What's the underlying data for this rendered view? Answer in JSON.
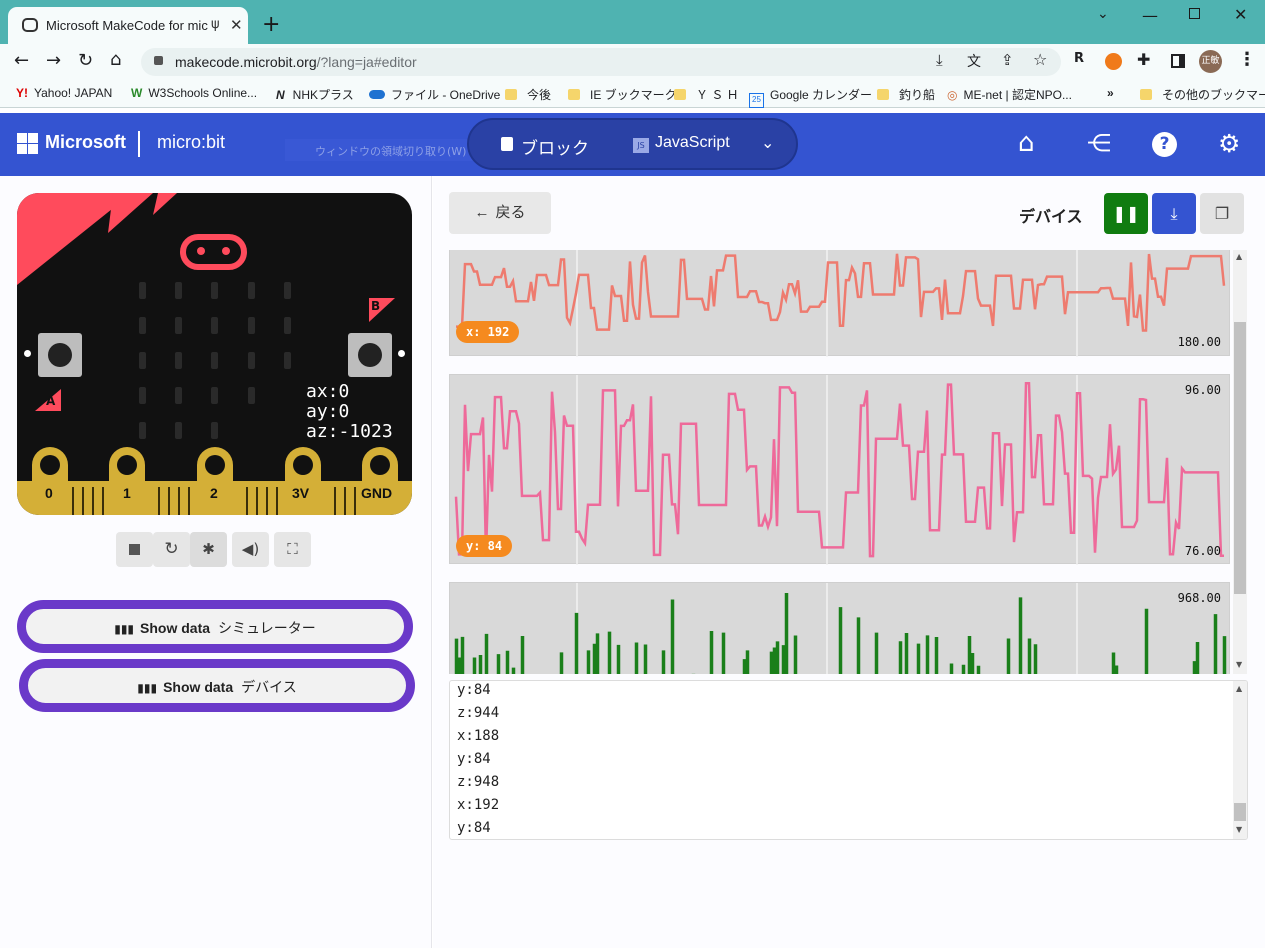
{
  "browser": {
    "tab_title": "Microsoft MakeCode for mic",
    "url_host": "makecode.microbit.org",
    "url_path": "/?lang=ja#editor",
    "bookmarks": [
      "Yahoo! JAPAN",
      "W3Schools Online...",
      "NHKプラス",
      "ファイル - OneDrive",
      "今後",
      "IE ブックマーク",
      "Ｙ Ｓ Ｈ",
      "Google カレンダー",
      "釣り船",
      "ME-net | 認定NPO...",
      "»",
      "その他のブックマーク"
    ],
    "profile_label": "正敏",
    "bm_initials": {
      "yahoo": "Y!",
      "w3": "W",
      "nhk": "N",
      "gcal": "25",
      "me": "◎"
    }
  },
  "header": {
    "brand": "Microsoft",
    "product": "micro:bit",
    "blocks_label": "ブロック",
    "js_label": "JavaScript",
    "js_icon_text": "JS",
    "tooltip": "ウィンドウの領域切り取り(W)"
  },
  "simulator": {
    "readout": [
      "ax:0",
      "ay:0",
      "az:-1023"
    ],
    "pins": [
      "0",
      "1",
      "2",
      "3V",
      "GND"
    ],
    "button_a": "A",
    "button_b": "B"
  },
  "show_data": [
    {
      "label": "Show data",
      "suffix": "シミュレーター"
    },
    {
      "label": "Show data",
      "suffix": "デバイス"
    }
  ],
  "device_view": {
    "back_label": "戻る",
    "title": "デバイス",
    "charts": [
      {
        "pill": "x: 192",
        "min": "180.00",
        "color": "#ee7b6f"
      },
      {
        "pill": "y: 84",
        "max": "96.00",
        "min": "76.00",
        "color": "#ee6a9a"
      },
      {
        "max": "968.00",
        "color": "#1a7f1a"
      }
    ],
    "console_lines": [
      "y:84",
      "z:944",
      "x:188",
      "y:84",
      "z:948",
      "x:192",
      "y:84"
    ]
  },
  "colors": {
    "header_blue": "#3454d1",
    "show_data_border": "#6a39c9",
    "green_btn": "#107c10",
    "blue_btn": "#3454d1"
  }
}
